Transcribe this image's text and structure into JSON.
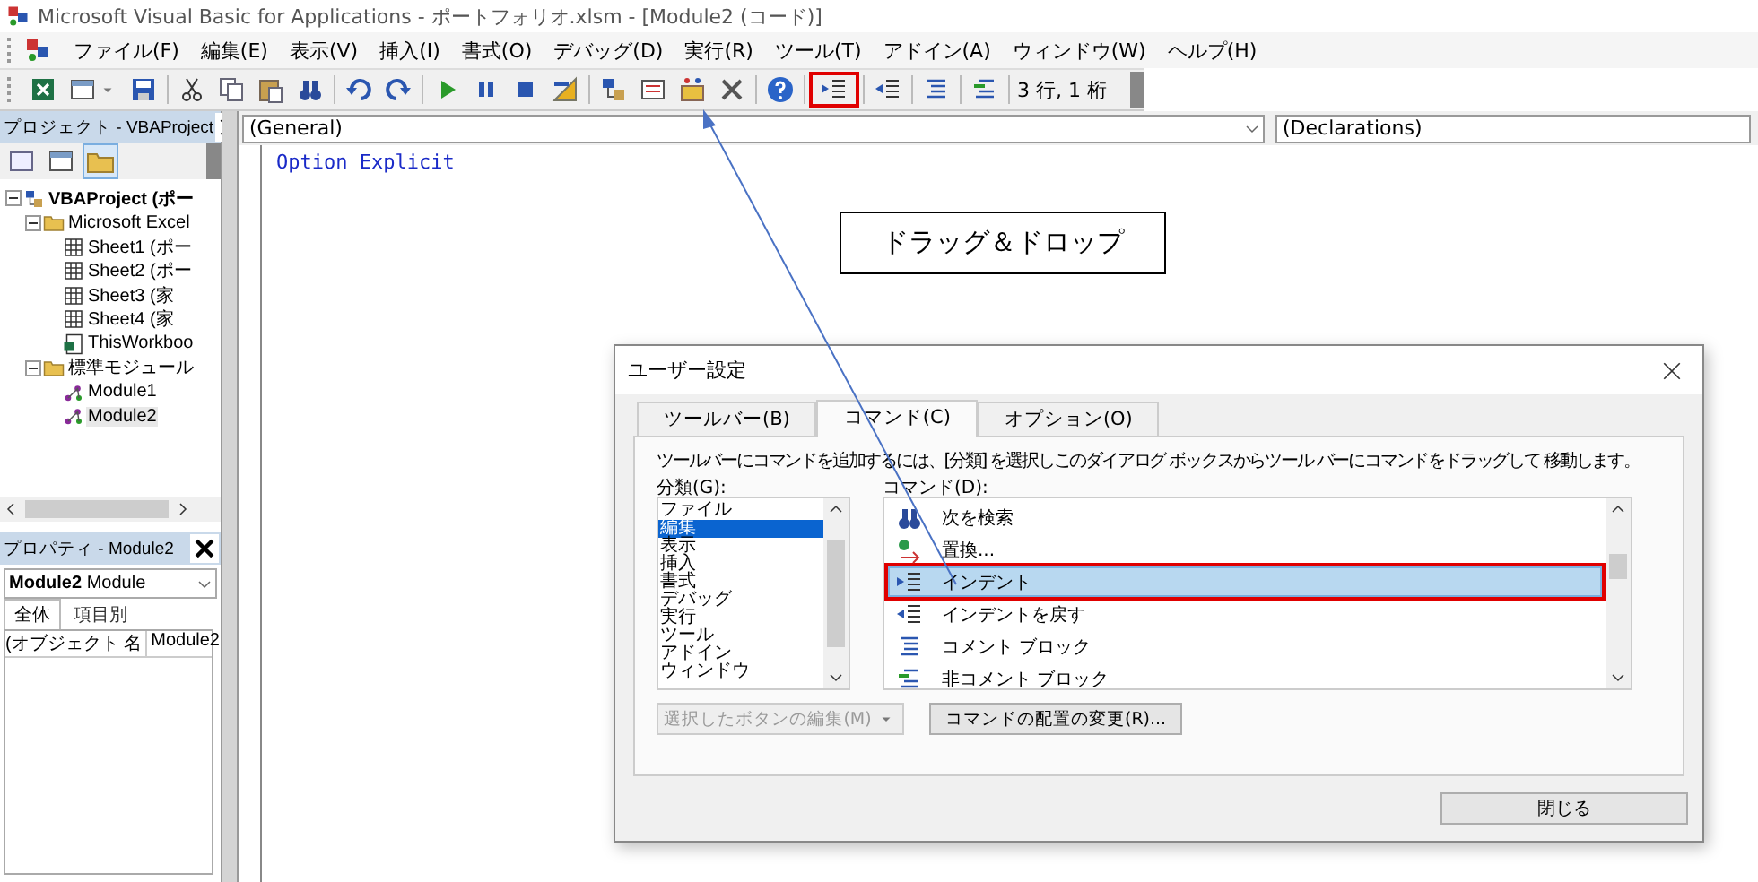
{
  "window": {
    "title": "Microsoft Visual Basic for Applications - ポートフォリオ.xlsm - [Module2 (コード)]"
  },
  "menu": [
    "ファイル(F)",
    "編集(E)",
    "表示(V)",
    "挿入(I)",
    "書式(O)",
    "デバッグ(D)",
    "実行(R)",
    "ツール(T)",
    "アドイン(A)",
    "ウィンドウ(W)",
    "ヘルプ(H)"
  ],
  "toolbar": {
    "items": [
      {
        "kind": "excel",
        "highlighted": false
      },
      {
        "kind": "form",
        "highlighted": false
      },
      {
        "kind": "save",
        "highlighted": false
      },
      {
        "kind": "separator"
      },
      {
        "kind": "cut",
        "highlighted": false
      },
      {
        "kind": "copy",
        "highlighted": false
      },
      {
        "kind": "paste",
        "highlighted": false
      },
      {
        "kind": "find",
        "highlighted": false
      },
      {
        "kind": "separator"
      },
      {
        "kind": "undo",
        "highlighted": false
      },
      {
        "kind": "redo",
        "highlighted": false
      },
      {
        "kind": "separator"
      },
      {
        "kind": "run",
        "highlighted": false
      },
      {
        "kind": "pause",
        "highlighted": false
      },
      {
        "kind": "stop",
        "highlighted": false
      },
      {
        "kind": "design",
        "highlighted": false
      },
      {
        "kind": "separator"
      },
      {
        "kind": "project",
        "highlighted": false
      },
      {
        "kind": "properties",
        "highlighted": false
      },
      {
        "kind": "object",
        "highlighted": false
      },
      {
        "kind": "toolbox",
        "highlighted": false
      },
      {
        "kind": "separator"
      },
      {
        "kind": "help",
        "highlighted": false
      },
      {
        "kind": "separator"
      },
      {
        "kind": "indent",
        "highlighted": true
      },
      {
        "kind": "separator"
      },
      {
        "kind": "outdent",
        "highlighted": false
      },
      {
        "kind": "separator"
      },
      {
        "kind": "comment",
        "highlighted": false
      },
      {
        "kind": "separator"
      },
      {
        "kind": "uncomment",
        "highlighted": false
      },
      {
        "kind": "separator"
      }
    ],
    "position": "3 行, 1 桁"
  },
  "project_pane": {
    "title": "プロジェクト - VBAProject",
    "tree": [
      {
        "kind": "project",
        "label": "VBAProject (ポー",
        "expanded": true,
        "selected": false,
        "children": [
          {
            "kind": "folder",
            "label": "Microsoft Excel",
            "expanded": true,
            "selected": false,
            "children": [
              {
                "kind": "sheet",
                "label": "Sheet1 (ポー",
                "selected": false
              },
              {
                "kind": "sheet",
                "label": "Sheet2 (ポー",
                "selected": false
              },
              {
                "kind": "sheet",
                "label": "Sheet3 (家",
                "selected": false
              },
              {
                "kind": "sheet",
                "label": "Sheet4 (家",
                "selected": false
              },
              {
                "kind": "workbook",
                "label": "ThisWorkboo",
                "selected": false
              }
            ]
          },
          {
            "kind": "folder",
            "label": "標準モジュール",
            "expanded": true,
            "selected": false,
            "children": [
              {
                "kind": "module",
                "label": "Module1",
                "selected": false
              },
              {
                "kind": "module",
                "label": "Module2",
                "selected": true
              }
            ]
          }
        ]
      }
    ]
  },
  "properties_pane": {
    "title": "プロパティ - Module2",
    "object": "**Module2** Module",
    "tabs": [
      {
        "label": "全体",
        "selected": true
      },
      {
        "label": "項目別",
        "selected": false
      }
    ],
    "rows": [
      {
        "name": "(オブジェクト 名",
        "value": "Module2"
      }
    ]
  },
  "code_window": {
    "object": "(General)",
    "procedure": "(Declarations)",
    "lines": [
      "Option Explicit"
    ]
  },
  "callout": "ドラッグ＆ドロップ",
  "dialog": {
    "title": "ユーザー設定",
    "tabs": [
      {
        "label": "ツールバー(B)",
        "selected": false
      },
      {
        "label": "コマンド(C)",
        "selected": true
      },
      {
        "label": "オプション(O)",
        "selected": false
      }
    ],
    "instruction": "ツールバーにコマンドを追加するには、[分類] を選択しこのダイアログ ボックスからツール バーにコマンドをドラッグして 移動します。",
    "categories_label": "分類(G):",
    "categories": [
      {
        "label": "ファイル",
        "selected": false
      },
      {
        "label": "編集",
        "selected": true
      },
      {
        "label": "表示",
        "selected": false
      },
      {
        "label": "挿入",
        "selected": false
      },
      {
        "label": "書式",
        "selected": false
      },
      {
        "label": "デバッグ",
        "selected": false
      },
      {
        "label": "実行",
        "selected": false
      },
      {
        "label": "ツール",
        "selected": false
      },
      {
        "label": "アドイン",
        "selected": false
      },
      {
        "label": "ウィンドウ",
        "selected": false
      }
    ],
    "commands_label": "コマンド(D):",
    "commands": [
      {
        "kind": "find",
        "label": "次を検索",
        "selected": false,
        "highlighted": false
      },
      {
        "kind": "replace",
        "label": "置換...",
        "selected": false,
        "highlighted": false
      },
      {
        "kind": "indent",
        "label": "インデント",
        "selected": true,
        "highlighted": true
      },
      {
        "kind": "outdent",
        "label": "インデントを戻す",
        "selected": false,
        "highlighted": false
      },
      {
        "kind": "comment",
        "label": "コメント ブロック",
        "selected": false,
        "highlighted": false
      },
      {
        "kind": "uncomment",
        "label": "非コメント ブロック",
        "selected": false,
        "highlighted": false
      }
    ],
    "modify_button": {
      "label": "選択したボタンの編集(M)",
      "disabled": true
    },
    "rearrange_button": {
      "label": "コマンドの配置の変更(R)...",
      "disabled": false
    },
    "close_button": "閉じる"
  }
}
